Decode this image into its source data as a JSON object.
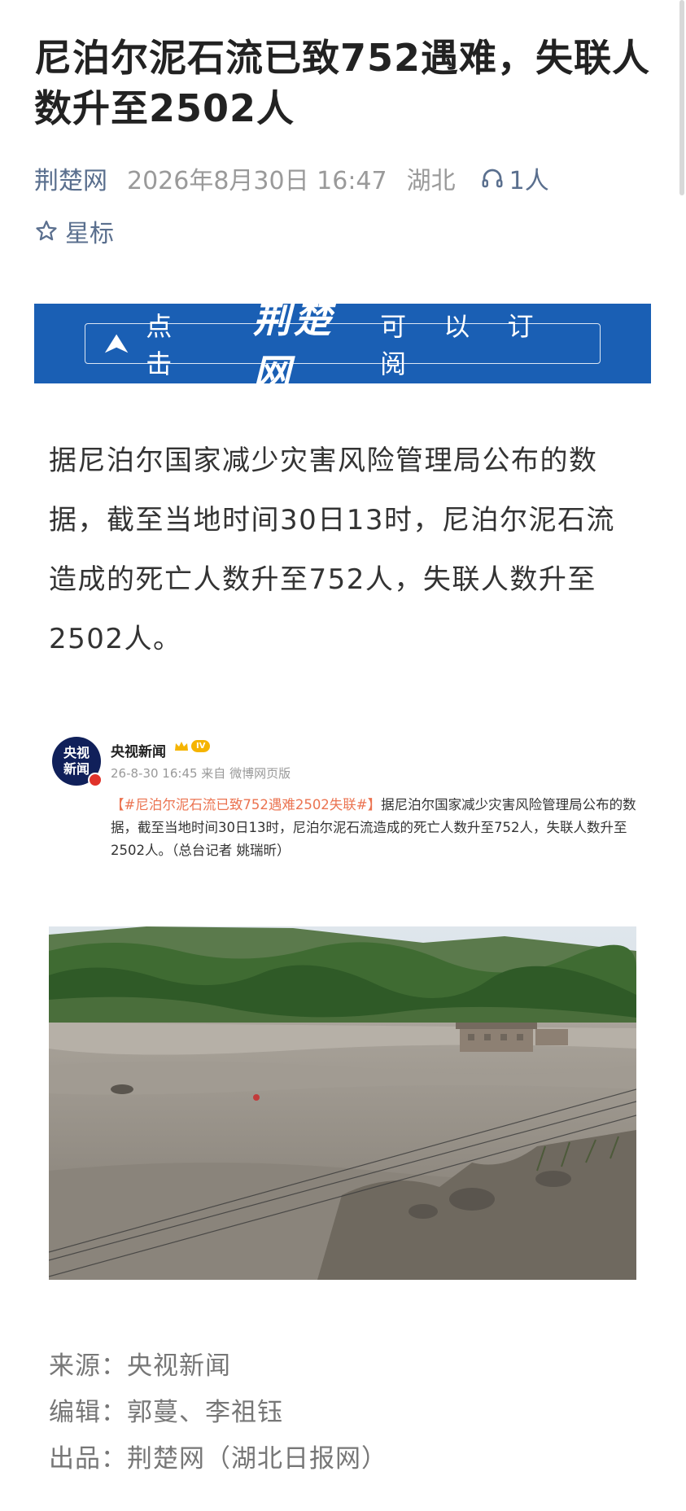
{
  "article": {
    "title": "尼泊尔泥石流已致752遇难，失联人数升至2502人",
    "source": "荆楚网",
    "datetime": "2026年8月30日 16:47",
    "region": "湖北",
    "listeners": "1人",
    "star_label": "星标"
  },
  "banner": {
    "text_left": "点 击",
    "brand": "荆楚网",
    "text_right": "可 以 订 阅",
    "color": "#1a5fb4"
  },
  "body": {
    "paragraph": "据尼泊尔国家减少灾害风险管理局公布的数据，截至当地时间30日13时，尼泊尔泥石流造成的死亡人数升至752人，失联人数升至2502人。"
  },
  "weibo": {
    "avatar_text_1": "央视",
    "avatar_text_2": "新闻",
    "account": "央视新闻",
    "level": "IV",
    "time": "26-8-30 16:45 来自 微博网页版",
    "hashtag": "【#尼泊尔泥石流已致752遇难2502失联#】",
    "text": "据尼泊尔国家减少灾害风险管理局公布的数据，截至当地时间30日13时，尼泊尔泥石流造成的死亡人数升至752人，失联人数升至2502人。（总台记者 姚瑞昕）"
  },
  "footer": {
    "source": "来源：央视新闻",
    "editor": "编辑：郭蔓、李祖钰",
    "producer": "出品：荆楚网（湖北日报网）"
  },
  "icons": {
    "headphone": "headphone-icon",
    "star": "star-outline-icon",
    "arrow": "triangle-arrow-icon"
  }
}
